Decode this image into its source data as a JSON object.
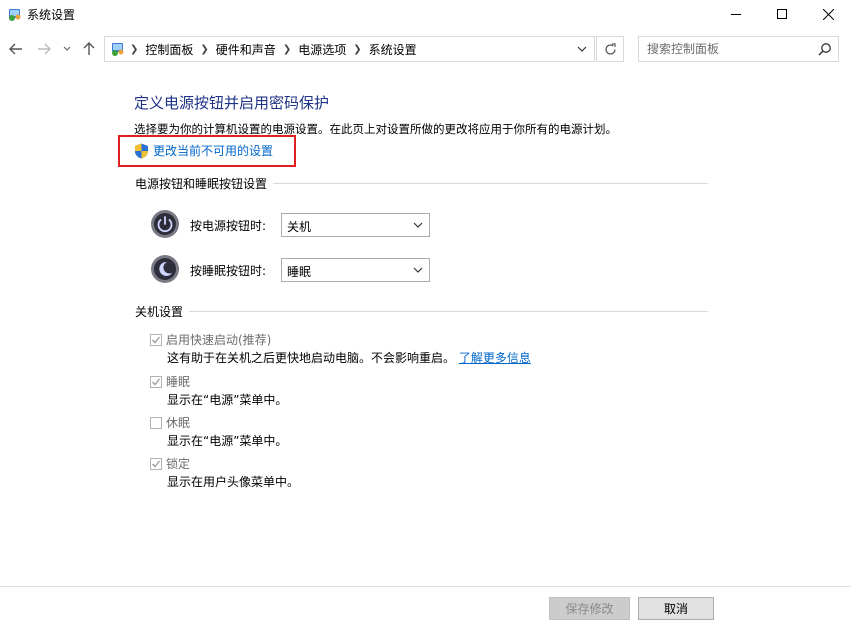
{
  "window": {
    "title": "系统设置",
    "app_icon": "control-panel-icon",
    "controls": [
      "minimize-icon",
      "maximize-icon",
      "close-icon"
    ]
  },
  "nav": {
    "back_icon": "back-arrow-icon",
    "forward_icon": "forward-arrow-icon",
    "recent_icon": "chevron-down-icon",
    "up_icon": "up-arrow-icon"
  },
  "breadcrumb": [
    "控制面板",
    "硬件和声音",
    "电源选项",
    "系统设置"
  ],
  "search": {
    "placeholder": "搜索控制面板"
  },
  "main": {
    "heading": "定义电源按钮并启用密码保护",
    "description": "选择要为你的计算机设置的电源设置。在此页上对设置所做的更改将应用于你所有的电源计划。",
    "change_link": "更改当前不可用的设置",
    "highlight_color": "#e02020",
    "section_buttons": "电源按钮和睡眠按钮设置",
    "power_button": {
      "label": "按电源按钮时:",
      "value": "关机"
    },
    "sleep_button": {
      "label": "按睡眠按钮时:",
      "value": "睡眠"
    },
    "section_shutdown": "关机设置",
    "options": [
      {
        "label": "启用快速启动(推荐)",
        "checked": true,
        "desc": "这有助于在关机之后更快地启动电脑。不会影响重启。",
        "link": "了解更多信息"
      },
      {
        "label": "睡眠",
        "checked": true,
        "desc": "显示在“电源”菜单中。"
      },
      {
        "label": "休眠",
        "checked": false,
        "desc": "显示在“电源”菜单中。"
      },
      {
        "label": "锁定",
        "checked": true,
        "desc": "显示在用户头像菜单中。"
      }
    ]
  },
  "footer": {
    "save_label": "保存修改",
    "cancel_label": "取消"
  }
}
